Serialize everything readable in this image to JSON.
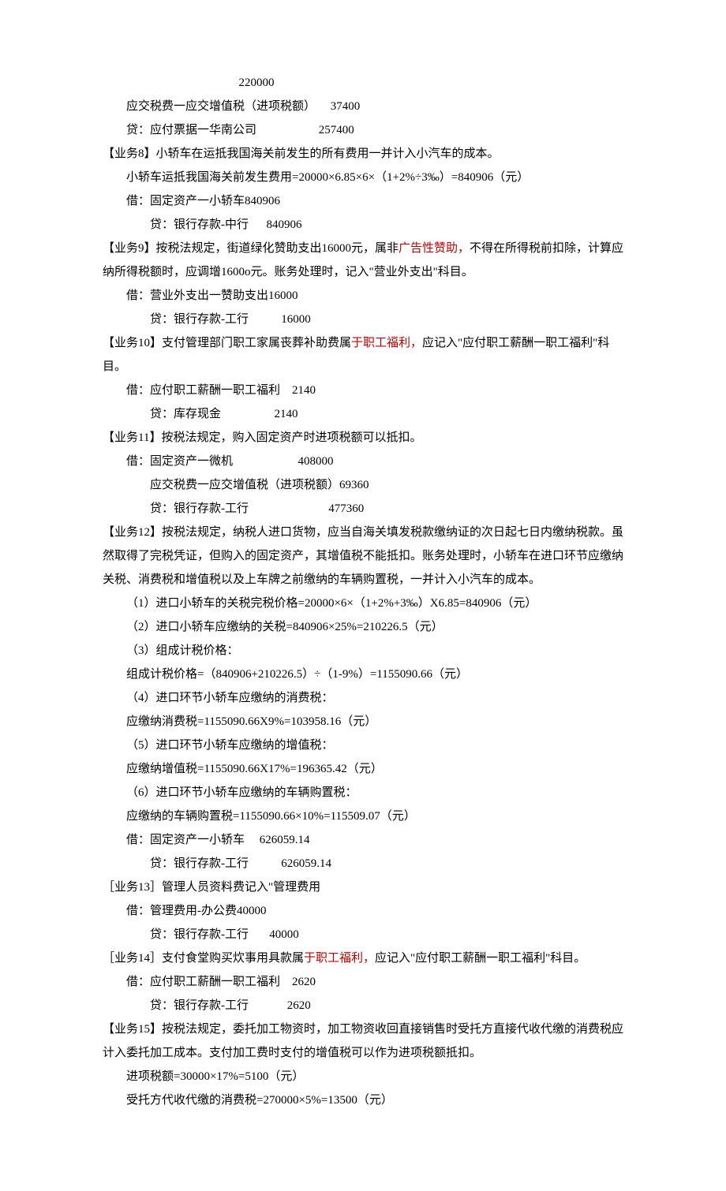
{
  "lines": [
    {
      "cls": "line",
      "segments": [
        {
          "text": "                                              220000"
        }
      ]
    },
    {
      "cls": "line indent1",
      "segments": [
        {
          "text": "应交税费一应交增值税（进项税额）     37400"
        }
      ]
    },
    {
      "cls": "line indent1",
      "segments": [
        {
          "text": "贷：应付票据一华南公司                     257400"
        }
      ]
    },
    {
      "cls": "line",
      "segments": [
        {
          "text": "【业务8】小轿车在运抵我国海关前发生的所有费用一并计入小汽车的成本。"
        }
      ]
    },
    {
      "cls": "line indent1",
      "segments": [
        {
          "text": "小轿车运抵我国海关前发生费用=20000×6.85×6×（1+2%÷3‰）=840906（元）"
        }
      ]
    },
    {
      "cls": "line indent1",
      "segments": [
        {
          "text": "借：固定资产一小轿车840906"
        }
      ]
    },
    {
      "cls": "line indent2",
      "segments": [
        {
          "text": "贷：银行存款-中行      840906"
        }
      ]
    },
    {
      "cls": "line",
      "segments": [
        {
          "text": "【业务9】按税法规定，街道绿化赞助支出16000元，属非"
        },
        {
          "text": "广告性赞助，",
          "red": true
        },
        {
          "text": "不得在所得税前扣除，计算应"
        }
      ]
    },
    {
      "cls": "line",
      "segments": [
        {
          "text": "纳所得税额时，应调增1600o元。账务处理时，记入\"营业外支出\"科目。"
        }
      ]
    },
    {
      "cls": "line indent1",
      "segments": [
        {
          "text": "借：营业外支出一赞助支出16000"
        }
      ]
    },
    {
      "cls": "line indent2",
      "segments": [
        {
          "text": "贷：银行存款-工行           16000"
        }
      ]
    },
    {
      "cls": "line",
      "segments": [
        {
          "text": "【业务10】支付管理部门职工家属丧葬补助费属"
        },
        {
          "text": "于职工福利，",
          "red": true
        },
        {
          "text": "应记入\"应付职工薪酬一职工福利\"科"
        }
      ]
    },
    {
      "cls": "line",
      "segments": [
        {
          "text": "目。"
        }
      ]
    },
    {
      "cls": "line indent1",
      "segments": [
        {
          "text": "借：应付职工薪酬一职工福利    2140"
        }
      ]
    },
    {
      "cls": "line indent2",
      "segments": [
        {
          "text": "贷：库存现金                  2140"
        }
      ]
    },
    {
      "cls": "line",
      "segments": [
        {
          "text": "【业务11】按税法规定，购入固定资产时进项税额可以抵扣。"
        }
      ]
    },
    {
      "cls": "line indent1",
      "segments": [
        {
          "text": "借：固定资产一微机                      408000"
        }
      ]
    },
    {
      "cls": "line indent2",
      "segments": [
        {
          "text": "应交税费一应交增值税（进项税额）69360"
        }
      ]
    },
    {
      "cls": "line indent2",
      "segments": [
        {
          "text": "贷：银行存款-工行                           477360"
        }
      ]
    },
    {
      "cls": "line",
      "segments": [
        {
          "text": "【业务12】按税法规定，纳税人进口货物，应当自海关填发税款缴纳证的次日起七日内缴纳税款。虽"
        }
      ]
    },
    {
      "cls": "line",
      "segments": [
        {
          "text": "然取得了完税凭证，但购入的固定资产，其增值税不能抵扣。账务处理时，小轿车在进口环节应缴纳"
        }
      ]
    },
    {
      "cls": "line",
      "segments": [
        {
          "text": "关税、消费税和增值税以及上车牌之前缴纳的车辆购置税，一并计入小汽车的成本。"
        }
      ]
    },
    {
      "cls": "line indent1",
      "segments": [
        {
          "text": "（1）进口小轿车的关税完税价格=20000×6×（1+2%+3‰）X6.85=840906（元）"
        }
      ]
    },
    {
      "cls": "line indent1",
      "segments": [
        {
          "text": "（2）进口小轿车应缴纳的关税=840906×25%=210226.5（元）"
        }
      ]
    },
    {
      "cls": "line indent1",
      "segments": [
        {
          "text": "（3）组成计税价格："
        }
      ]
    },
    {
      "cls": "line indent1",
      "segments": [
        {
          "text": "组成计税价格=（840906+210226.5）÷（1-9%）=1155090.66（元）"
        }
      ]
    },
    {
      "cls": "line indent1",
      "segments": [
        {
          "text": "（4）进口环节小轿车应缴纳的消费税："
        }
      ]
    },
    {
      "cls": "line indent1",
      "segments": [
        {
          "text": "应缴纳消费税=1155090.66X9%=103958.16（元）"
        }
      ]
    },
    {
      "cls": "line indent1",
      "segments": [
        {
          "text": "（5）进口环节小轿车应缴纳的增值税："
        }
      ]
    },
    {
      "cls": "line indent1",
      "segments": [
        {
          "text": "应缴纳增值税=1155090.66X17%=196365.42（元）"
        }
      ]
    },
    {
      "cls": "line indent1",
      "segments": [
        {
          "text": "（6）进口环节小轿车应缴纳的车辆购置税："
        }
      ]
    },
    {
      "cls": "line indent1",
      "segments": [
        {
          "text": "应缴纳的车辆购置税=1155090.66×10%=115509.07（元）"
        }
      ]
    },
    {
      "cls": "line indent1",
      "segments": [
        {
          "text": "借：固定资产一小轿车     626059.14"
        }
      ]
    },
    {
      "cls": "line indent2",
      "segments": [
        {
          "text": "贷：银行存款-工行           626059.14"
        }
      ]
    },
    {
      "cls": "line",
      "segments": [
        {
          "text": "［业务13］管理人员资料费记入\"管理费用"
        }
      ]
    },
    {
      "cls": "line indent1",
      "segments": [
        {
          "text": "借：管理费用-办公费40000"
        }
      ]
    },
    {
      "cls": "line indent2",
      "segments": [
        {
          "text": "贷：银行存款-工行       40000"
        }
      ]
    },
    {
      "cls": "line",
      "segments": [
        {
          "text": "［业务14］支付食堂购买炊事用具款属"
        },
        {
          "text": "于职工福利，",
          "red": true
        },
        {
          "text": "应记入\"应付职工薪酬一职工福利\"科目。"
        }
      ]
    },
    {
      "cls": "line indent1",
      "segments": [
        {
          "text": "借：应付职工薪酬一职工福利    2620"
        }
      ]
    },
    {
      "cls": "line indent2",
      "segments": [
        {
          "text": "贷：银行存款-工行             2620"
        }
      ]
    },
    {
      "cls": "line",
      "segments": [
        {
          "text": "【业务15】按税法规定，委托加工物资时，加工物资收回直接销售时受托方直接代收代缴的消费税应"
        }
      ]
    },
    {
      "cls": "line",
      "segments": [
        {
          "text": "计入委托加工成本。支付加工费时支付的增值税可以作为进项税额抵扣。"
        }
      ]
    },
    {
      "cls": "line indent1",
      "segments": [
        {
          "text": "进项税额=30000×17%=5100（元）"
        }
      ]
    },
    {
      "cls": "line indent1",
      "segments": [
        {
          "text": "受托方代收代缴的消费税=270000×5%=13500（元）"
        }
      ]
    }
  ]
}
